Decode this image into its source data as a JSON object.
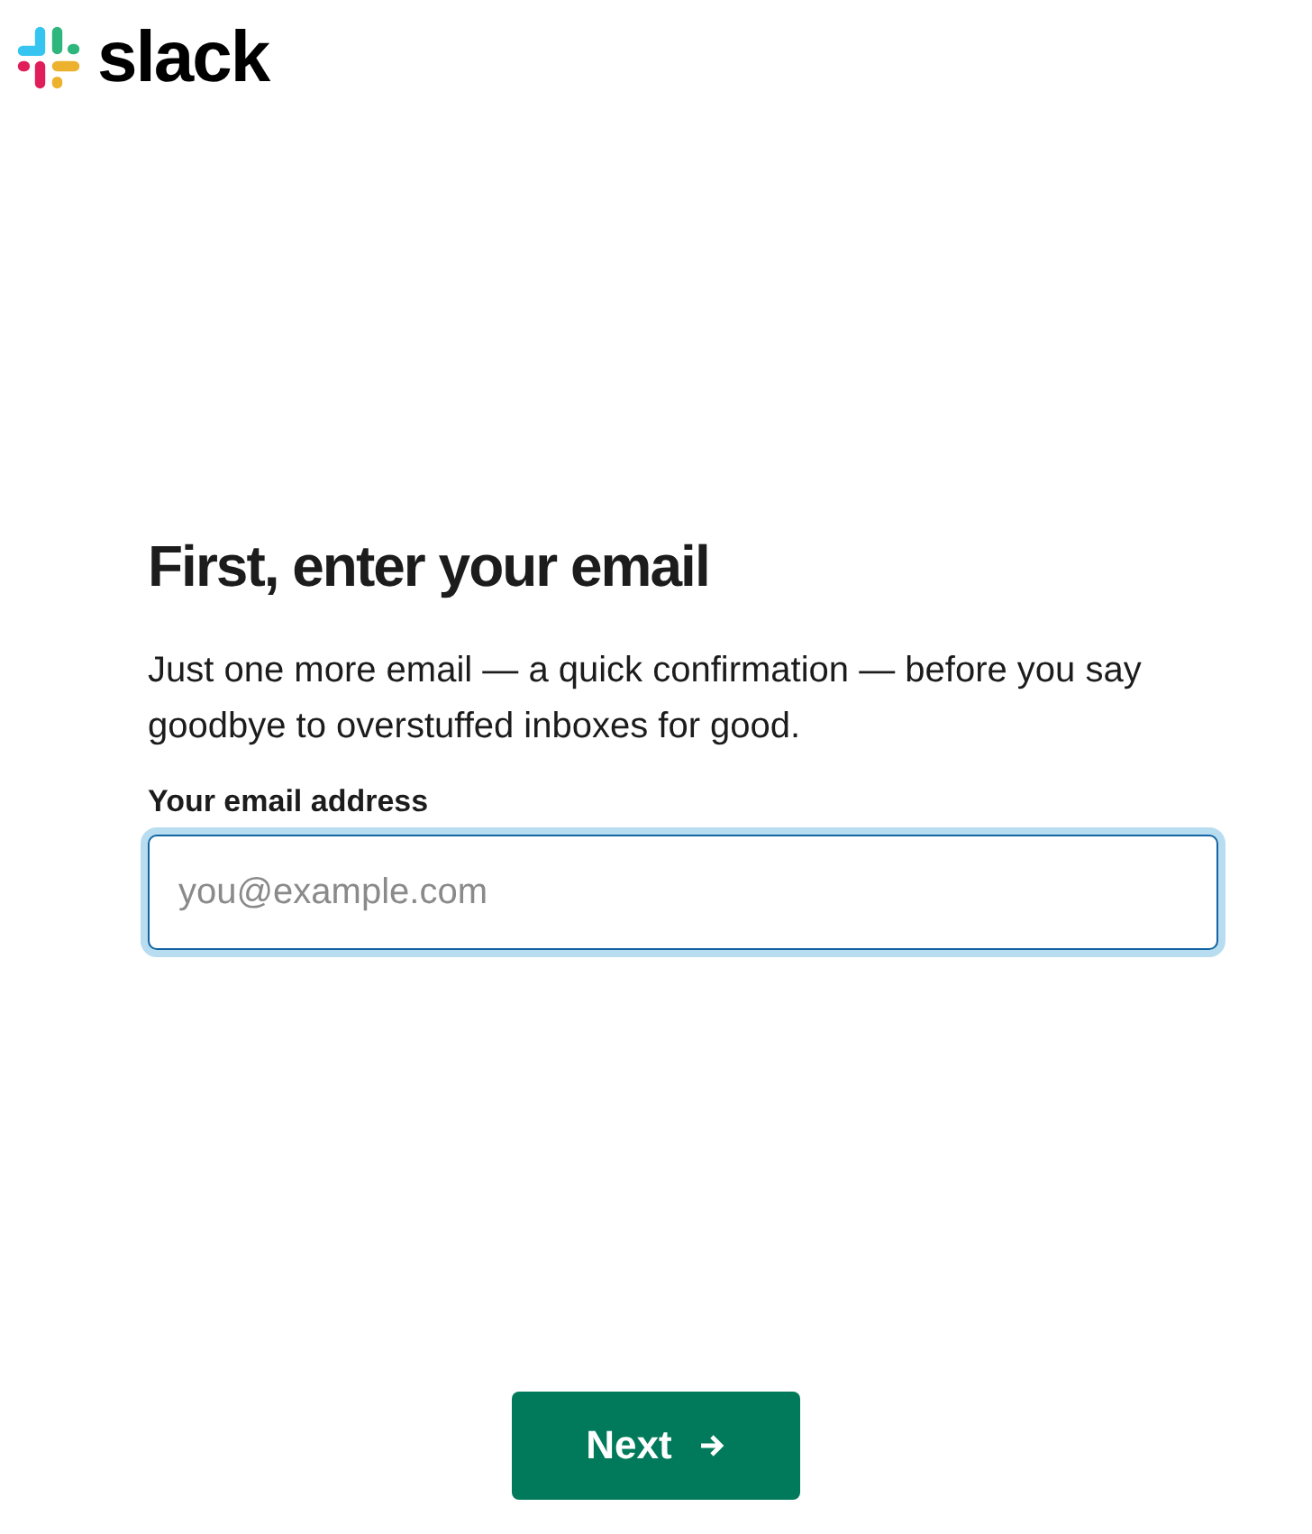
{
  "header": {
    "logo_text": "slack"
  },
  "form": {
    "title": "First, enter your email",
    "description": "Just one more email — a quick confirmation — before you say goodbye to overstuffed inboxes for good.",
    "email_field": {
      "label": "Your email address",
      "placeholder": "you@example.com",
      "focused": true
    }
  },
  "buttons": [
    {
      "label": "Next",
      "kind": "primary"
    }
  ]
}
